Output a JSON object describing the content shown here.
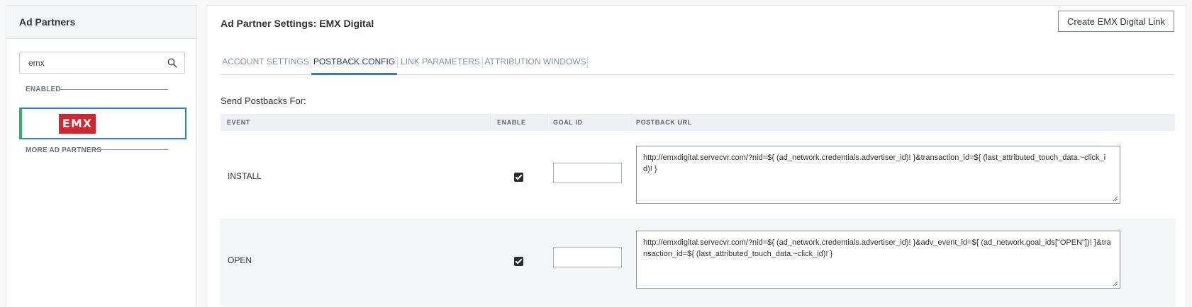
{
  "sidebar": {
    "title": "Ad Partners",
    "search": {
      "value": "emx",
      "placeholder": ""
    },
    "enabled_label": "ENABLED",
    "more_label": "MORE AD PARTNERS",
    "enabled_partners": [
      {
        "logo_text": "EMX",
        "logo_color": "#d1252f"
      }
    ]
  },
  "main": {
    "title": "Ad Partner Settings: EMX Digital",
    "create_button": "Create EMX Digital Link",
    "tabs": [
      {
        "label": "ACCOUNT SETTINGS",
        "active": false
      },
      {
        "label": "POSTBACK CONFIG",
        "active": true
      },
      {
        "label": "LINK PARAMETERS",
        "active": false
      },
      {
        "label": "ATTRIBUTION WINDOWS",
        "active": false
      }
    ],
    "send_label": "Send Postbacks For:",
    "table": {
      "headers": [
        "EVENT",
        "ENABLE",
        "GOAL ID",
        "POSTBACK URL"
      ],
      "rows": [
        {
          "event": "INSTALL",
          "enabled": true,
          "goal_id": "",
          "postback_url": "http://emxdigital.servecvr.com/?nid=${ (ad_network.credentials.advertiser_id)! }&transaction_id=${ (last_attributed_touch_data.~click_id)! }"
        },
        {
          "event": "OPEN",
          "enabled": true,
          "goal_id": "",
          "postback_url": "http://emxdigital.servecvr.com/?nid=${ (ad_network.credentials.advertiser_id)! }&adv_event_id=${ (ad_network.goal_ids[\"OPEN\"])! }&transaction_id=${ (last_attributed_touch_data.~click_id)! }"
        }
      ]
    }
  },
  "colors": {
    "accent": "#2f7fd0",
    "enabled_bar": "#2fb36a",
    "brand_red": "#d1252f"
  }
}
